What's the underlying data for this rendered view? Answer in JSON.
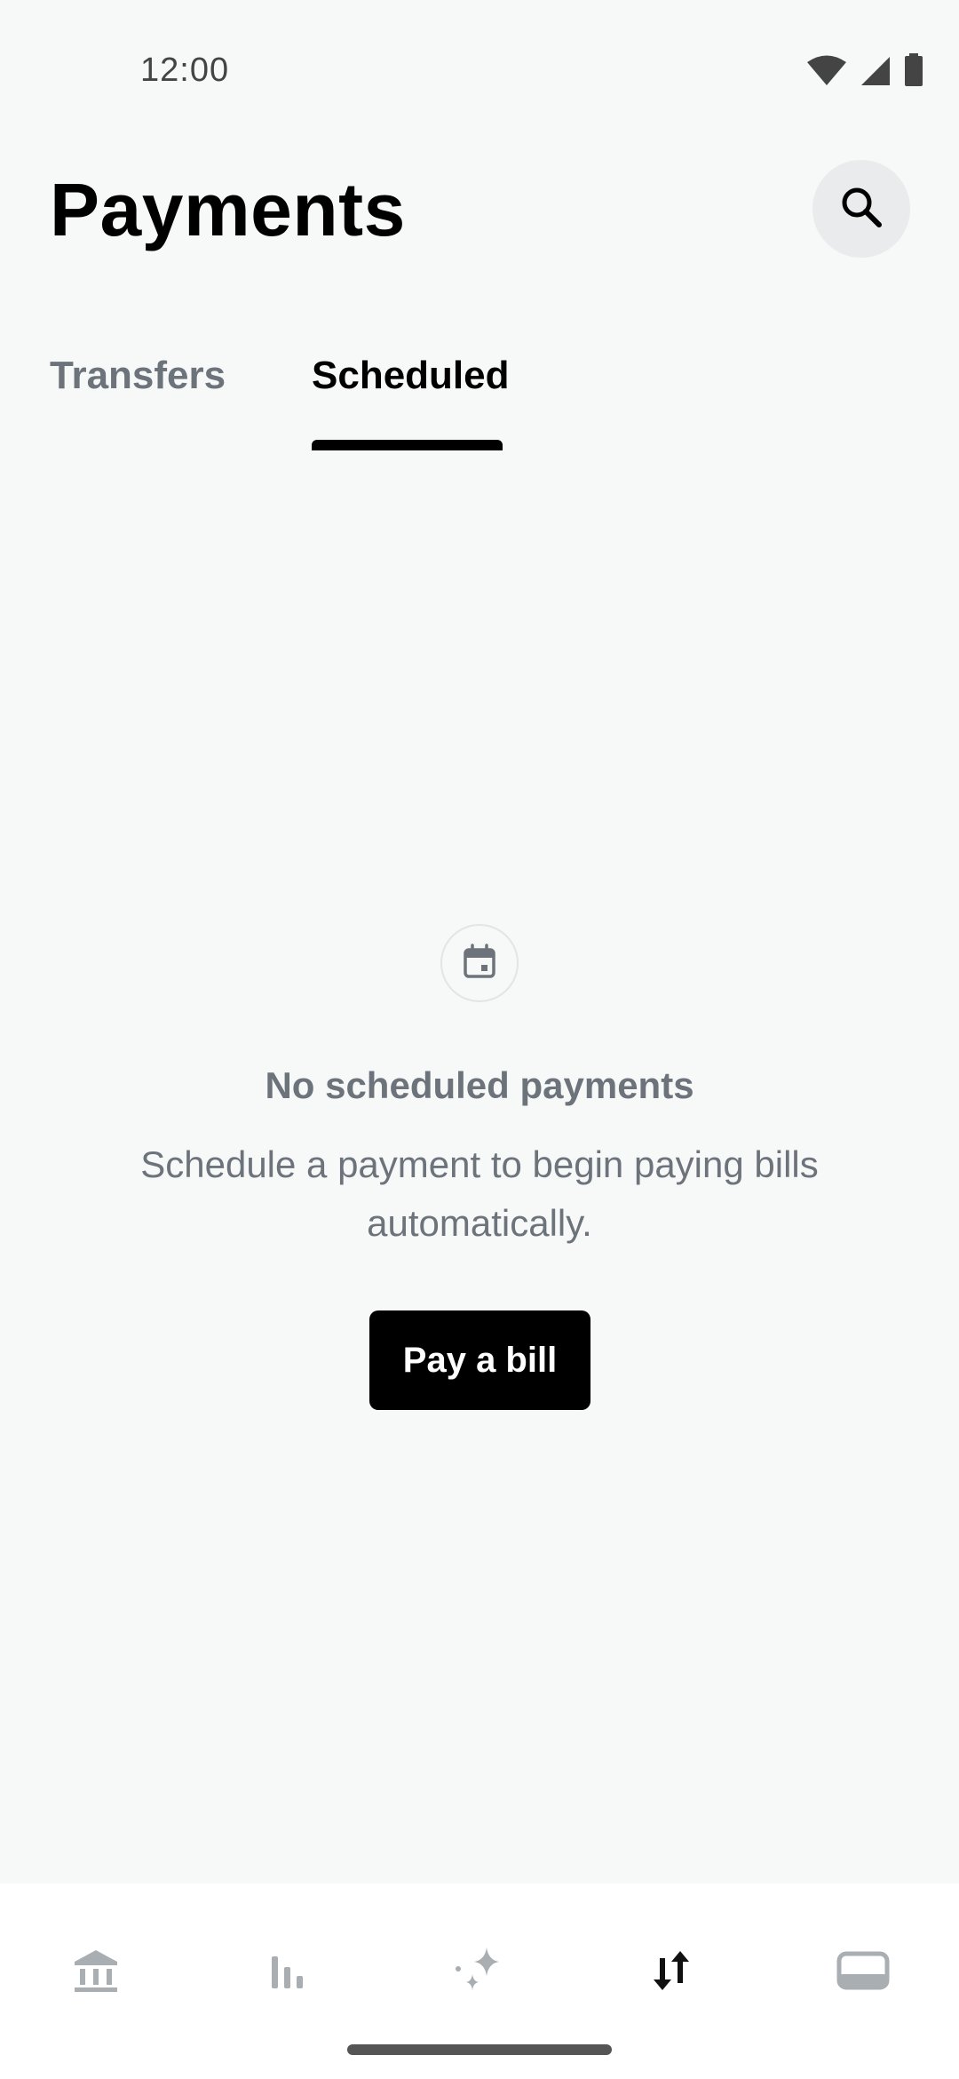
{
  "status_bar": {
    "time": "12:00",
    "icons": [
      "wifi-icon",
      "signal-icon",
      "battery-icon"
    ]
  },
  "header": {
    "title": "Payments",
    "search_icon": "search-icon"
  },
  "tabs": [
    {
      "label": "Transfers",
      "selected": false
    },
    {
      "label": "Scheduled",
      "selected": true
    }
  ],
  "empty_state": {
    "icon": "calendar-icon",
    "title": "No scheduled payments",
    "subtitle": "Schedule a payment to begin paying bills automatically.",
    "button_label": "Pay a bill"
  },
  "bottom_nav": {
    "items": [
      {
        "icon": "bank-icon",
        "selected": false
      },
      {
        "icon": "bar-chart-icon",
        "selected": false
      },
      {
        "icon": "sparkle-icon",
        "selected": false
      },
      {
        "icon": "transfer-arrows-icon",
        "selected": true
      },
      {
        "icon": "card-icon",
        "selected": false
      }
    ]
  },
  "colors": {
    "background": "#f7f8f8",
    "muted_text": "#6c737b",
    "primary": "#000000",
    "nav_inactive": "#a9aeb3"
  }
}
